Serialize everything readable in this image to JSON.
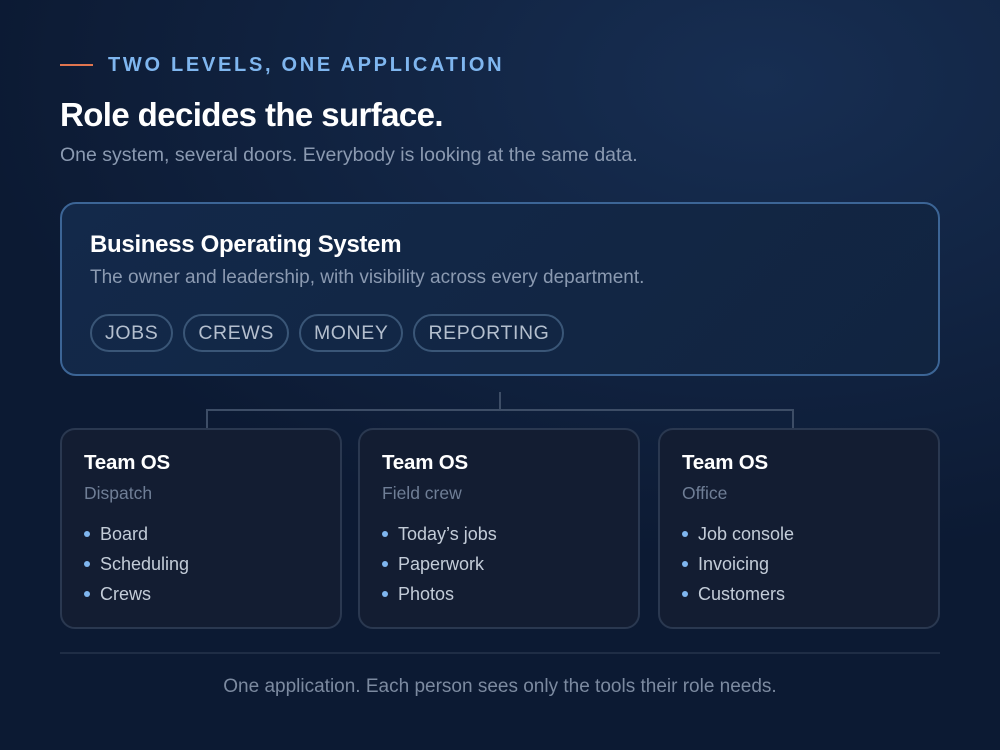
{
  "eyebrow": "TWO LEVELS, ONE APPLICATION",
  "title": "Role decides the surface.",
  "subtitle": "One system, several doors. Everybody is looking at the same data.",
  "business": {
    "title": "Business Operating System",
    "description": "The owner and leadership, with visibility across every department.",
    "tags": [
      "JOBS",
      "CREWS",
      "MONEY",
      "REPORTING"
    ]
  },
  "teams": [
    {
      "title": "Team OS",
      "role": "Dispatch",
      "items": [
        "Board",
        "Scheduling",
        "Crews"
      ]
    },
    {
      "title": "Team OS",
      "role": "Field crew",
      "items": [
        "Today’s jobs",
        "Paperwork",
        "Photos"
      ]
    },
    {
      "title": "Team OS",
      "role": "Office",
      "items": [
        "Job console",
        "Invoicing",
        "Customers"
      ]
    }
  ],
  "footer": "One application. Each person sees only the tools their role needs.",
  "colors": {
    "background": "#0c1a33",
    "accent_rule": "#e0754f",
    "eyebrow": "#7fb6ef",
    "bullet": "#7fb6ef",
    "top_card_border": "#3c6596",
    "connector": "#3d4d66"
  }
}
